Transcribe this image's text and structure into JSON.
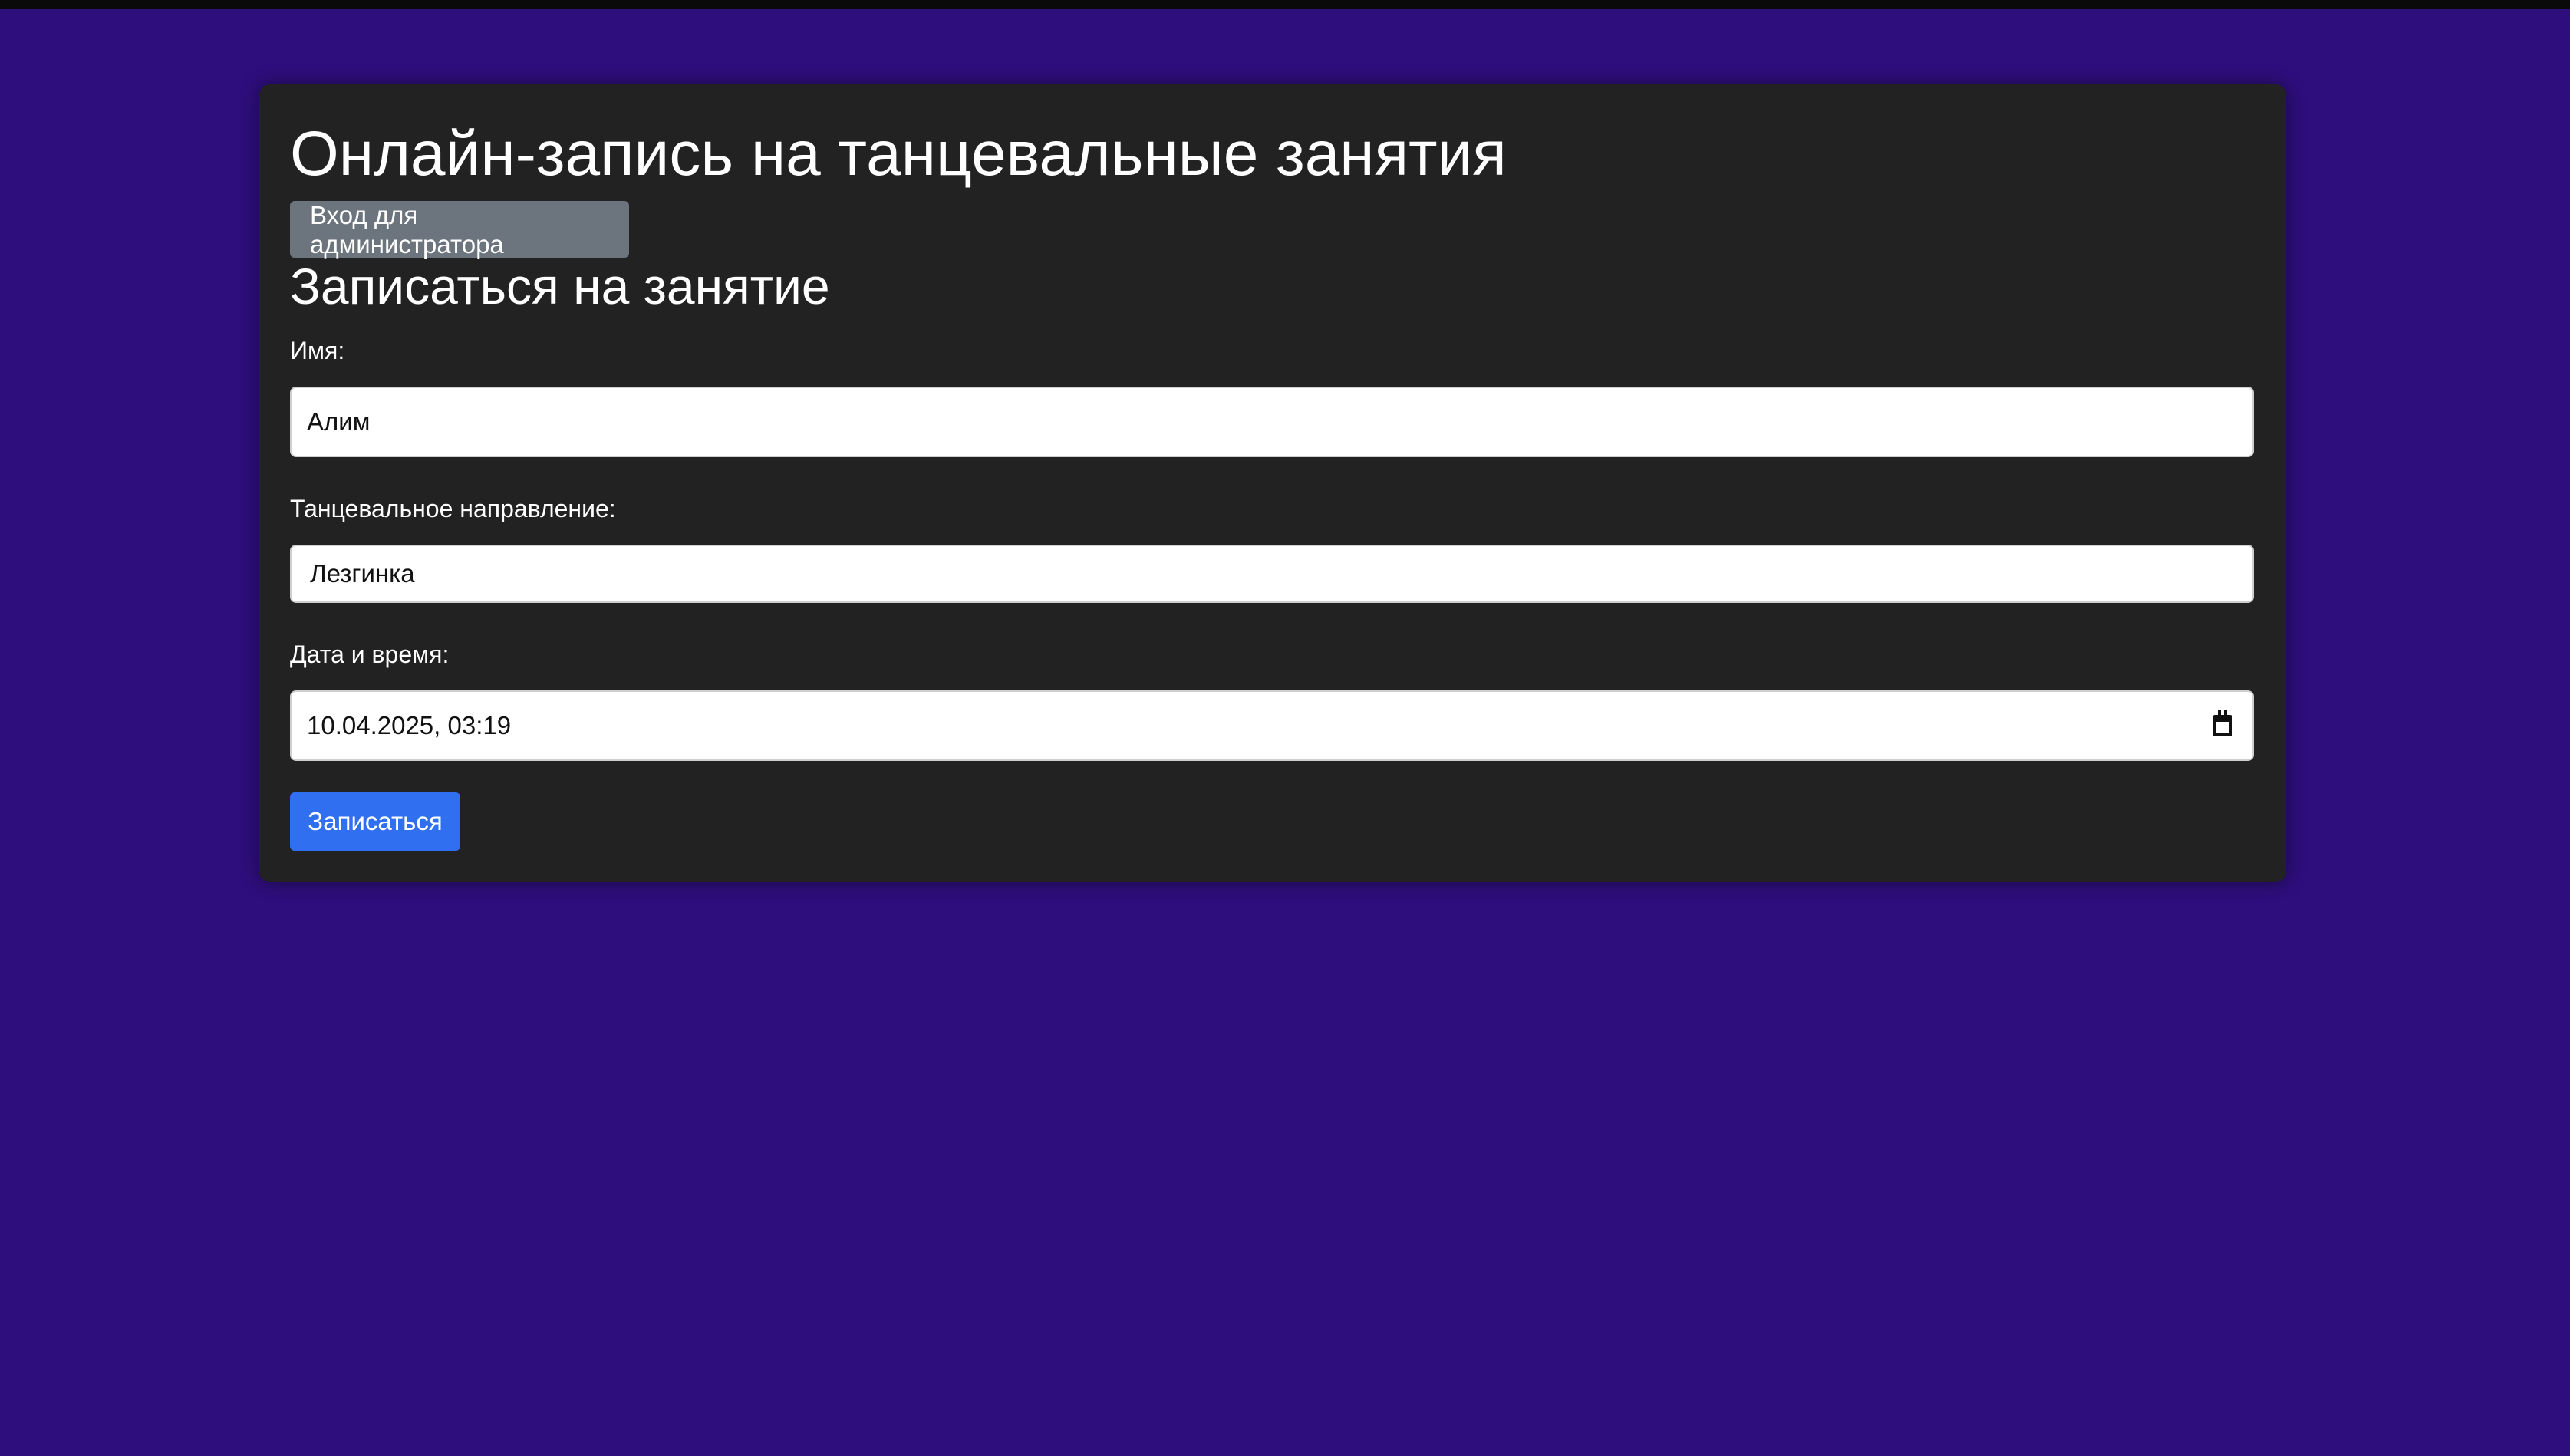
{
  "page": {
    "title": "Онлайн-запись на танцевальные занятия",
    "background_color": "#2e0e7c",
    "card_color": "#222222"
  },
  "admin": {
    "login_label": "Вход для администратора",
    "button_color": "#6c757d"
  },
  "booking": {
    "section_title": "Записаться на занятие",
    "name": {
      "label": "Имя:",
      "value": "Алим"
    },
    "dance": {
      "label": "Танцевальное направление:",
      "value": "Лезгинка"
    },
    "datetime": {
      "label": "Дата и время:",
      "value": "10.04.2025, 03:19",
      "icon": "calendar-icon"
    },
    "submit_label": "Записаться",
    "submit_color": "#2f6ff0"
  }
}
